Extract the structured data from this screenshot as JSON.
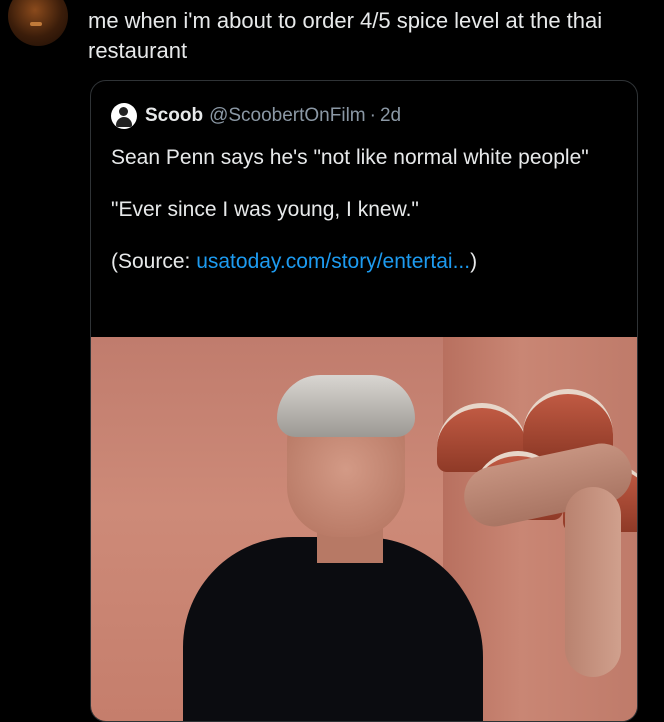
{
  "post": {
    "text": "me when i'm about to order 4/5 spice level at the thai restaurant",
    "avatar_icon": "profile-avatar"
  },
  "quoted_post": {
    "display_name": "Scoob",
    "handle": "@ScoobertOnFilm",
    "separator": "·",
    "time": "2d",
    "line1": "Sean Penn says he's \"not like normal white people\"",
    "line2": "\"Ever since I was young, I knew.\"",
    "source_prefix": "(Source: ",
    "source_link": "usatoday.com/story/entertai...",
    "source_suffix": ")",
    "image_icon": "photo-of-man-leaning-on-tiled-wall"
  },
  "colors": {
    "background": "#000000",
    "text": "#e7e9ea",
    "secondary": "#8b98a5",
    "link": "#1d9bf0",
    "border": "#2f3336"
  }
}
